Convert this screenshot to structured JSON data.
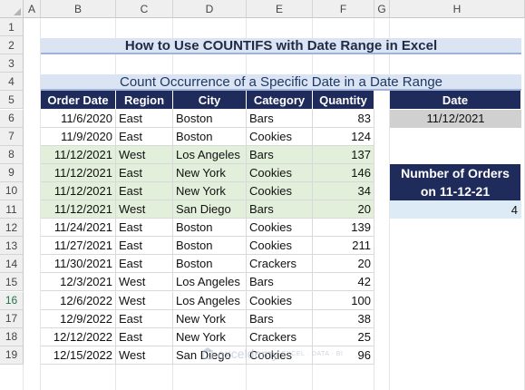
{
  "columns": [
    "A",
    "B",
    "C",
    "D",
    "E",
    "F",
    "G",
    "H"
  ],
  "rows": [
    "1",
    "2",
    "3",
    "4",
    "5",
    "6",
    "7",
    "8",
    "9",
    "10",
    "11",
    "12",
    "13",
    "14",
    "15",
    "16",
    "17",
    "18",
    "19"
  ],
  "title": "How to Use COUNTIFS with Date Range in Excel",
  "subtitle": "Count Occurrence of a Specific Date in a Date Range",
  "table": {
    "headers": [
      "Order Date",
      "Region",
      "City",
      "Category",
      "Quantity"
    ],
    "rows": [
      [
        "11/6/2020",
        "East",
        "Boston",
        "Bars",
        "83"
      ],
      [
        "11/9/2020",
        "East",
        "Boston",
        "Cookies",
        "124"
      ],
      [
        "11/12/2021",
        "West",
        "Los Angeles",
        "Bars",
        "137"
      ],
      [
        "11/12/2021",
        "East",
        "New York",
        "Cookies",
        "146"
      ],
      [
        "11/12/2021",
        "East",
        "New York",
        "Cookies",
        "34"
      ],
      [
        "11/12/2021",
        "West",
        "San Diego",
        "Bars",
        "20"
      ],
      [
        "11/24/2021",
        "East",
        "Boston",
        "Cookies",
        "139"
      ],
      [
        "11/27/2021",
        "East",
        "Boston",
        "Cookies",
        "211"
      ],
      [
        "11/30/2021",
        "East",
        "Boston",
        "Crackers",
        "20"
      ],
      [
        "12/3/2021",
        "West",
        "Los Angeles",
        "Bars",
        "42"
      ],
      [
        "12/6/2022",
        "West",
        "Los Angeles",
        "Cookies",
        "100"
      ],
      [
        "12/9/2022",
        "East",
        "New York",
        "Bars",
        "38"
      ],
      [
        "12/12/2022",
        "East",
        "New York",
        "Crackers",
        "25"
      ],
      [
        "12/15/2022",
        "West",
        "San Diego",
        "Cookies",
        "96"
      ]
    ],
    "highlighted_rows": [
      2,
      3,
      4,
      5
    ],
    "highlight_color": "#e2efda",
    "header_color": "#1f2b5a"
  },
  "date_box": {
    "label": "Date",
    "value": "11/12/2021"
  },
  "result_box": {
    "label_line1": "Number of Orders",
    "label_line2": "on 11-12-21",
    "value": "4"
  },
  "watermark": {
    "name": "exceldemy",
    "tagline": "EXCEL · DATA · BI"
  }
}
